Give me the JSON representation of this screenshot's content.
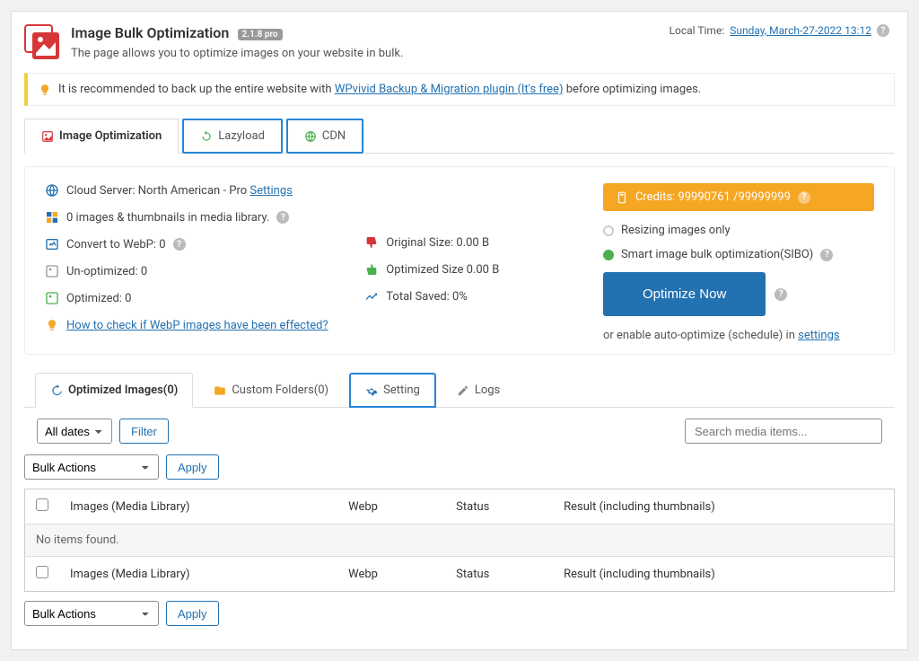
{
  "header": {
    "title": "Image Bulk Optimization",
    "badge": "2.1.8 pro",
    "subtitle": "The page allows you to optimize images on your website in bulk.",
    "local_time_label": "Local Time:",
    "local_time_value": "Sunday, March-27-2022 13:12"
  },
  "notice": {
    "pre": "It is recommended to back up the entire website with ",
    "link": "WPvivid Backup & Migration plugin (It's free)",
    "post": " before optimizing images."
  },
  "main_tabs": {
    "optimization": "Image Optimization",
    "lazyload": "Lazyload",
    "cdn": "CDN"
  },
  "stats": {
    "cloud_server_label": "Cloud Server: North American - Pro ",
    "cloud_server_link": "Settings",
    "media_library": "0 images & thumbnails in media library.",
    "webp_label": "Convert to WebP: 0",
    "unoptimized": "Un-optimized: 0",
    "optimized": "Optimized: 0",
    "webp_help_link": "How to check if WebP images have been effected?",
    "original_size": "Original Size: 0.00 B",
    "optimized_size": "Optimized Size 0.00 B",
    "total_saved": "Total Saved: 0%"
  },
  "right_panel": {
    "credits": "Credits: 99990761 /99999999",
    "mode_resize": "Resizing images only",
    "mode_sibo": "Smart image bulk optimization(SIBO)",
    "optimize_btn": "Optimize Now",
    "auto_text_pre": "or enable auto-optimize (schedule) in ",
    "auto_text_link": "settings"
  },
  "sub_tabs": {
    "optimized_images": "Optimized Images(0)",
    "custom_folders": "Custom Folders(0)",
    "setting": "Setting",
    "logs": "Logs"
  },
  "filter": {
    "dates_option": "All dates",
    "filter_btn": "Filter",
    "search_placeholder": "Search media items..."
  },
  "bulk": {
    "bulk_actions": "Bulk Actions",
    "apply": "Apply"
  },
  "table": {
    "col_images": "Images (Media Library)",
    "col_webp": "Webp",
    "col_status": "Status",
    "col_result": "Result (including thumbnails)",
    "no_items": "No items found."
  }
}
